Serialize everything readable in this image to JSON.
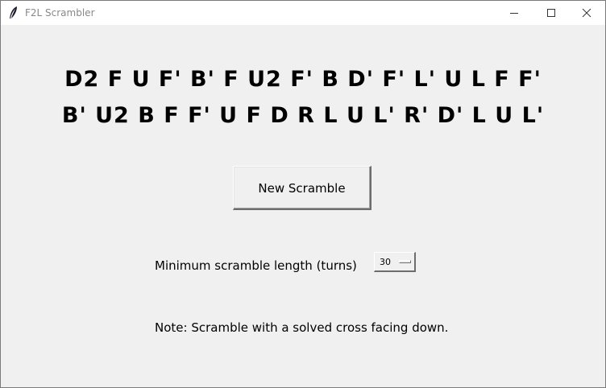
{
  "window": {
    "title": "F2L Scrambler",
    "icon": "feather-icon",
    "controls": {
      "minimize": "minimize-icon",
      "maximize": "maximize-icon",
      "close": "close-icon"
    }
  },
  "scramble": {
    "line1": "D2 F U F' B' F U2 F' B D' F' L' U L F F'",
    "line2": "B' U2 B F F' U F D R L U L' R' D' L U L'"
  },
  "new_scramble_label": "New Scramble",
  "min_length": {
    "label": "Minimum scramble length (turns)",
    "selected_value": "30"
  },
  "note": "Note: Scramble with a solved cross facing down."
}
